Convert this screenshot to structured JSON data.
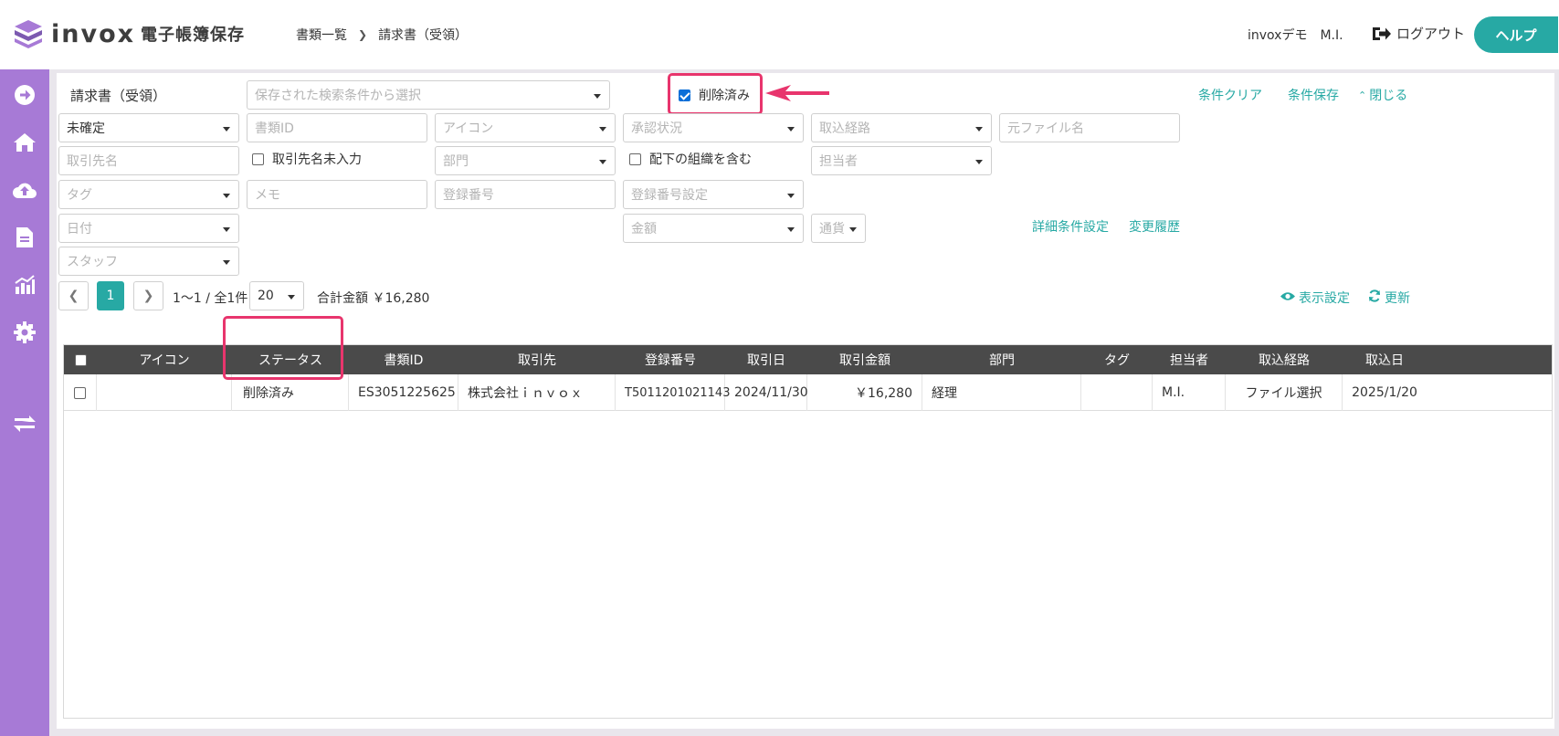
{
  "header": {
    "brand": "invox",
    "brand_sub": "電子帳簿保存",
    "breadcrumb_root": "書類一覧",
    "breadcrumb_current": "請求書（受領）",
    "user": "invoxデモ　M.I.",
    "logout": "ログアウト",
    "help": "ヘルプ"
  },
  "sidebar": {
    "icons": [
      "arrow-right-circle-icon",
      "home-icon",
      "cloud-upload-icon",
      "document-icon",
      "chart-icon",
      "gear-icon",
      "transfer-icon"
    ]
  },
  "filters": {
    "doc_type": "請求書（受領）",
    "saved_search_placeholder": "保存された検索条件から選択",
    "deleted_label": "削除済み",
    "deleted_checked": true,
    "clear": "条件クリア",
    "save": "条件保存",
    "close": "閉じる",
    "status_value": "未確定",
    "doc_id_placeholder": "書類ID",
    "icon_placeholder": "アイコン",
    "approval_placeholder": "承認状況",
    "route_placeholder": "取込経路",
    "filename_placeholder": "元ファイル名",
    "partner_placeholder": "取引先名",
    "partner_empty_label": "取引先名未入力",
    "dept_placeholder": "部門",
    "include_sub_label": "配下の組織を含む",
    "owner_placeholder": "担当者",
    "tag_placeholder": "タグ",
    "memo_placeholder": "メモ",
    "regno_placeholder": "登録番号",
    "regno_setting_placeholder": "登録番号設定",
    "date_placeholder": "日付",
    "amount_placeholder": "金額",
    "currency_placeholder": "通貨",
    "detail_settings": "詳細条件設定",
    "change_history": "変更履歴",
    "staff_placeholder": "スタッフ"
  },
  "pagination": {
    "current_page": "1",
    "range": "1〜1 / 全1件",
    "per_page": "20",
    "total": "合計金額 ￥16,280",
    "display_settings": "表示設定",
    "refresh": "更新"
  },
  "table": {
    "headers": [
      "アイコン",
      "ステータス",
      "書類ID",
      "取引先",
      "登録番号",
      "取引日",
      "取引金額",
      "部門",
      "タグ",
      "担当者",
      "取込経路",
      "取込日"
    ],
    "rows": [
      {
        "icon": "",
        "status": "削除済み",
        "doc_id": "ES3051225625",
        "partner": "株式会社ｉｎｖｏｘ",
        "reg_no": "T5011201021143",
        "trade_date": "2024/11/30",
        "amount": "￥16,280",
        "dept": "経理",
        "tag": "",
        "owner": "M.I.",
        "route": "ファイル選択",
        "import_date": "2025/1/20"
      }
    ]
  },
  "colors": {
    "accent": "#27a9a4",
    "sidebar": "#a77ad6",
    "highlight": "#e8356d",
    "table_header": "#4a4a4a"
  }
}
